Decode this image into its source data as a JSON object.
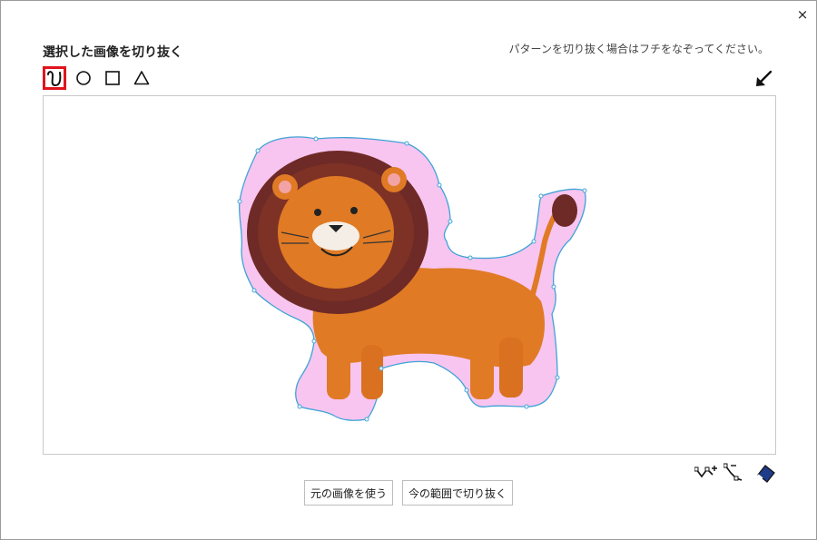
{
  "dialog": {
    "close_label": "×",
    "title": "選択した画像を切り抜く",
    "hint": "パターンを切り抜く場合はフチをなぞってください。"
  },
  "tools": [
    {
      "name": "freehand",
      "icon": "freehand-curve-icon",
      "active": true
    },
    {
      "name": "circle",
      "icon": "circle-icon",
      "active": false
    },
    {
      "name": "square",
      "icon": "square-icon",
      "active": false
    },
    {
      "name": "triangle",
      "icon": "triangle-icon",
      "active": false
    }
  ],
  "edit_tools": [
    "add-point-icon",
    "remove-point-icon",
    "eraser-icon"
  ],
  "buttons": {
    "use_original": "元の画像を使う",
    "crop_current": "今の範囲で切り抜く"
  },
  "colors": {
    "active_tool_border": "#e0141d",
    "selection_fill": "#f7c5f0",
    "selection_stroke": "#3fa3d6",
    "lion_body": "#e07a24",
    "lion_mane": "#6e2a26"
  }
}
